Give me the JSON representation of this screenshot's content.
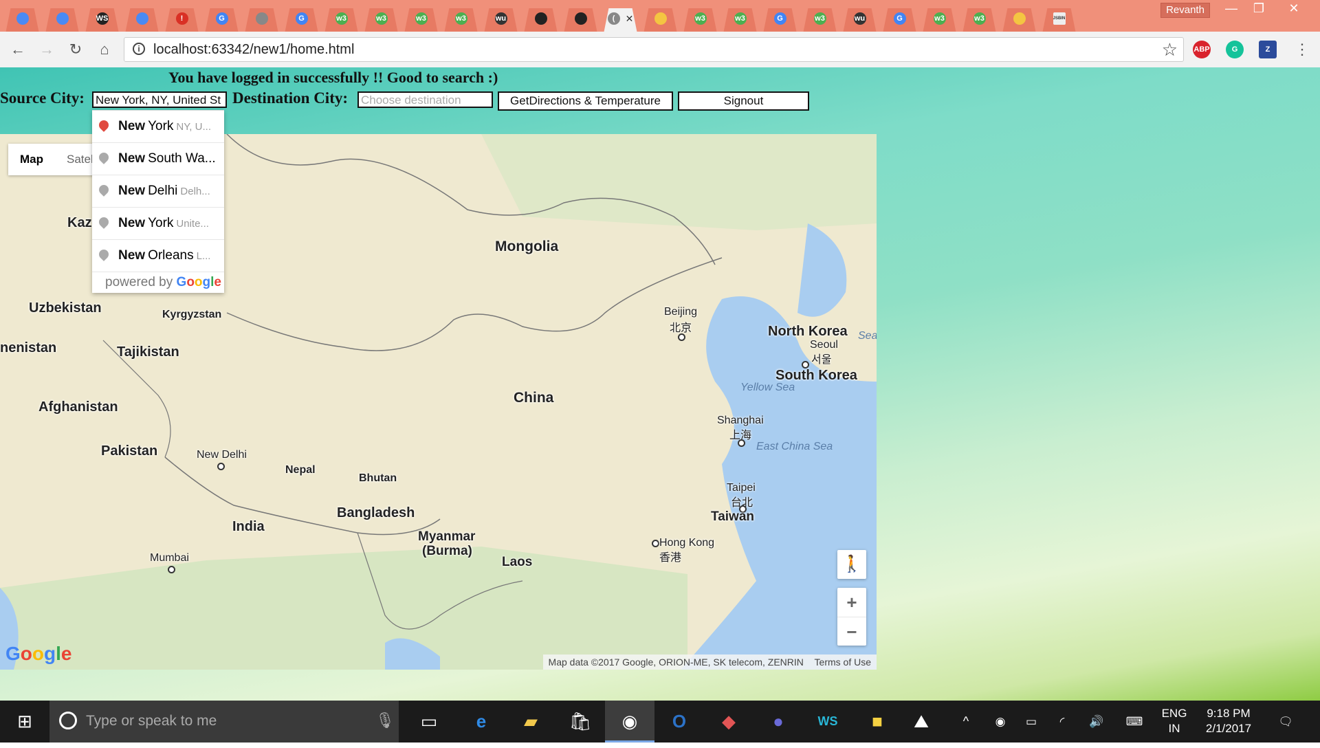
{
  "browser": {
    "profile_name": "Revanth",
    "tabs": [
      {
        "icon": "chrome-icon",
        "color": "#4a8af4"
      },
      {
        "icon": "chrome-icon",
        "color": "#4a8af4"
      },
      {
        "icon": "webstorm-icon",
        "color": "#222222",
        "label": "WS"
      },
      {
        "icon": "chrome-icon",
        "color": "#4a8af4"
      },
      {
        "icon": "alert-icon",
        "color": "#d93025",
        "label": "!"
      },
      {
        "icon": "google-icon",
        "color": "#4285f4",
        "label": "G"
      },
      {
        "icon": "file-icon",
        "color": "#888888"
      },
      {
        "icon": "google-icon",
        "color": "#4285f4",
        "label": "G"
      },
      {
        "icon": "w3schools-icon",
        "color": "#4caf50",
        "label": "w3"
      },
      {
        "icon": "w3schools-icon",
        "color": "#4caf50",
        "label": "w3"
      },
      {
        "icon": "w3schools-icon",
        "color": "#4caf50",
        "label": "w3"
      },
      {
        "icon": "w3schools-icon",
        "color": "#4caf50",
        "label": "w3"
      },
      {
        "icon": "wu-icon",
        "color": "#333333",
        "label": "wu"
      },
      {
        "icon": "github-icon",
        "color": "#222222"
      },
      {
        "icon": "github-icon",
        "color": "#222222"
      },
      {
        "icon": "loading-icon",
        "color": "#888888",
        "label": "(",
        "active": true
      },
      {
        "icon": "bulb-icon",
        "color": "#f4c542"
      },
      {
        "icon": "w3schools-icon",
        "color": "#4caf50",
        "label": "w3"
      },
      {
        "icon": "w3schools-icon",
        "color": "#4caf50",
        "label": "w3"
      },
      {
        "icon": "google-icon",
        "color": "#4285f4",
        "label": "G"
      },
      {
        "icon": "w3schools-icon",
        "color": "#4caf50",
        "label": "w3"
      },
      {
        "icon": "wu-icon",
        "color": "#333333",
        "label": "wu"
      },
      {
        "icon": "google-icon",
        "color": "#4285f4",
        "label": "G"
      },
      {
        "icon": "w3schools-icon",
        "color": "#4caf50",
        "label": "w3"
      },
      {
        "icon": "w3schools-icon",
        "color": "#4caf50",
        "label": "w3"
      },
      {
        "icon": "bulb-icon",
        "color": "#f4c542"
      },
      {
        "icon": "jsbin-icon",
        "color": "#eeeeee",
        "label": "JSBIN"
      }
    ],
    "active_tab_close": "✕",
    "url": "localhost:63342/new1/home.html",
    "extensions": [
      {
        "name": "adblock-plus-icon",
        "label": "ABP",
        "color": "#d9232d"
      },
      {
        "name": "grammarly-icon",
        "label": "G",
        "color": "#15c39a"
      },
      {
        "name": "zotero-icon",
        "label": "Z",
        "color": "#2b4b9b"
      }
    ]
  },
  "page": {
    "welcome": "You have logged in successfully !! Good to search :)",
    "source_label": "Source City:",
    "source_value": "New York, NY, United St",
    "destination_label": "Destination City:",
    "destination_placeholder": "Choose destination",
    "directions_button": "GetDirections & Temperature",
    "signout_button": "Signout"
  },
  "autocomplete": {
    "items": [
      {
        "match": "New",
        "rest": "York",
        "secondary": "NY, U...",
        "selected": true
      },
      {
        "match": "New",
        "rest": "South Wa...",
        "secondary": ""
      },
      {
        "match": "New",
        "rest": "Delhi",
        "secondary": "Delh..."
      },
      {
        "match": "New",
        "rest": "York",
        "secondary": "Unite..."
      },
      {
        "match": "New",
        "rest": "Orleans",
        "secondary": "L..."
      }
    ],
    "powered_by": "powered by",
    "powered_brand": "Google"
  },
  "map": {
    "type_map": "Map",
    "type_satellite": "Satel",
    "zoom_in": "+",
    "zoom_out": "−",
    "logo": "Google",
    "attribution": "Map data ©2017 Google, ORION-ME, SK telecom, ZENRIN",
    "terms": "Terms of Use",
    "labels": {
      "kaz": "Kaz",
      "mongolia": "Mongolia",
      "uzbekistan": "Uzbekistan",
      "kyrgyzstan": "Kyrgyzstan",
      "turkmenistan": "nenistan",
      "tajikistan": "Tajikistan",
      "afghanistan": "Afghanistan",
      "pakistan": "Pakistan",
      "new_delhi": "New Delhi",
      "nepal": "Nepal",
      "bhutan": "Bhutan",
      "bangladesh": "Bangladesh",
      "india": "India",
      "mumbai": "Mumbai",
      "myanmar": "Myanmar",
      "burma": "(Burma)",
      "laos": "Laos",
      "china": "China",
      "beijing": "Beijing",
      "beijing_cn": "北京",
      "north_korea": "North Korea",
      "seoul": "Seoul",
      "seoul_kr": "서울",
      "south_korea": "South Korea",
      "yellow_sea": "Yellow Sea",
      "sea": "Sea",
      "shanghai": "Shanghai",
      "shanghai_cn": "上海",
      "east_china_sea": "East China Sea",
      "taipei": "Taipei",
      "taipei_cn": "台北",
      "taiwan": "Taiwan",
      "hong_kong": "Hong Kong",
      "hong_kong_cn": "香港"
    }
  },
  "taskbar": {
    "search_placeholder": "Type or speak to me",
    "language": "ENG",
    "region": "IN",
    "time": "9:18 PM",
    "date": "2/1/2017"
  }
}
